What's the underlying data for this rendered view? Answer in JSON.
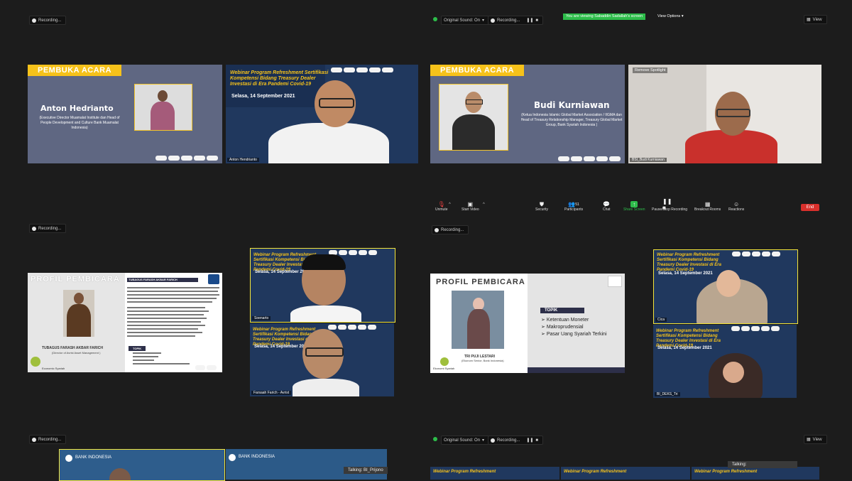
{
  "recording_label": "Recording...",
  "top_right": {
    "original_sound": "Original Sound: On",
    "viewing_banner": "You are viewing Sabaddin Sadallah's screen",
    "view_options": "View Options",
    "view": "View"
  },
  "q1": {
    "banner": "PEMBUKA ACARA",
    "name": "Anton Hedrianto",
    "desc": "(Executive Director Muamalat Institute dan Head of People Development and Culture Bank Muamalat Indonesia)",
    "webinar_title": "Webinar Program Refreshment Sertifikasi Kompetensi Bidang Treasury Dealer Investasi di Era Pandemi Covid-19",
    "webinar_date": "Selasa, 14 September 2021",
    "video_name": "Anton Hendrianto"
  },
  "q2": {
    "banner": "PEMBUKA ACARA",
    "name": "Budi Kurniawan",
    "desc": "(Ketua Indonesia Islamic Global Market Association / IIGMA dan Head of Treasury Relationship Manager, Treasury Global Market Group, Bank Syariah Indonesia )",
    "remove_spotlight": "Remove Spotlight",
    "video_name": "BSI_Budi Kurniawan"
  },
  "toolbar": {
    "unmute": "Unmute",
    "start_video": "Start Video",
    "security": "Security",
    "participants": "Participants",
    "participants_count": "51",
    "chat": "Chat",
    "share_screen": "Share Screen",
    "record": "Pause/Stop Recording",
    "breakout": "Breakout Rooms",
    "reactions": "Reactions",
    "end": "End"
  },
  "q3": {
    "profile_title": "PROFIL PEMBICARA",
    "name": "TUBAGUS FARASH AKBAR FARICH",
    "role": "(Director of Avrist Asset Management )",
    "topik": "TOPIK",
    "sponsor": "Economic Syariah",
    "webinar_title": "Webinar Program Refreshment Sertifikasi Kompetensi Bidang Treasury Dealer Investasi di Era Pandemi Covid-19",
    "webinar_date": "Selasa, 14 September 2021",
    "video1_name": "Soenarto",
    "video2_name": "Farsaah Farich - Avrist"
  },
  "q4": {
    "profile_title": "PROFIL PEMBICARA",
    "topik": "TOPIK",
    "topics": [
      "Ketentuan Moneter",
      "Makroprudensial",
      "Pasar Uang Syariah Terkini"
    ],
    "name": "TRI PUJI LESTARI",
    "role": "(Ekonom Senior, Bank Indonesia)",
    "sponsor": "Ekonomi Syariah",
    "webinar_title": "Webinar Program Refreshment Sertifikasi Kompetensi Bidang Treasury Dealer Investasi di Era Pandemi Covid-19",
    "webinar_date": "Selasa, 14 September 2021",
    "video1_name": "Cica",
    "video2_name": "BI_DEKS_Tri"
  },
  "q5": {
    "bank_label": "BANK INDONESIA",
    "talking": "Talking: BI_Prijono"
  },
  "q6": {
    "original_sound": "Original Sound: On",
    "talking": "Talking:",
    "view": "View"
  },
  "colors": {
    "accent": "#f6c21a",
    "slide_bg": "#5f6782",
    "webinar_bg": "#20385e",
    "end_red": "#d9302c",
    "share_green": "#2dbd4a"
  }
}
